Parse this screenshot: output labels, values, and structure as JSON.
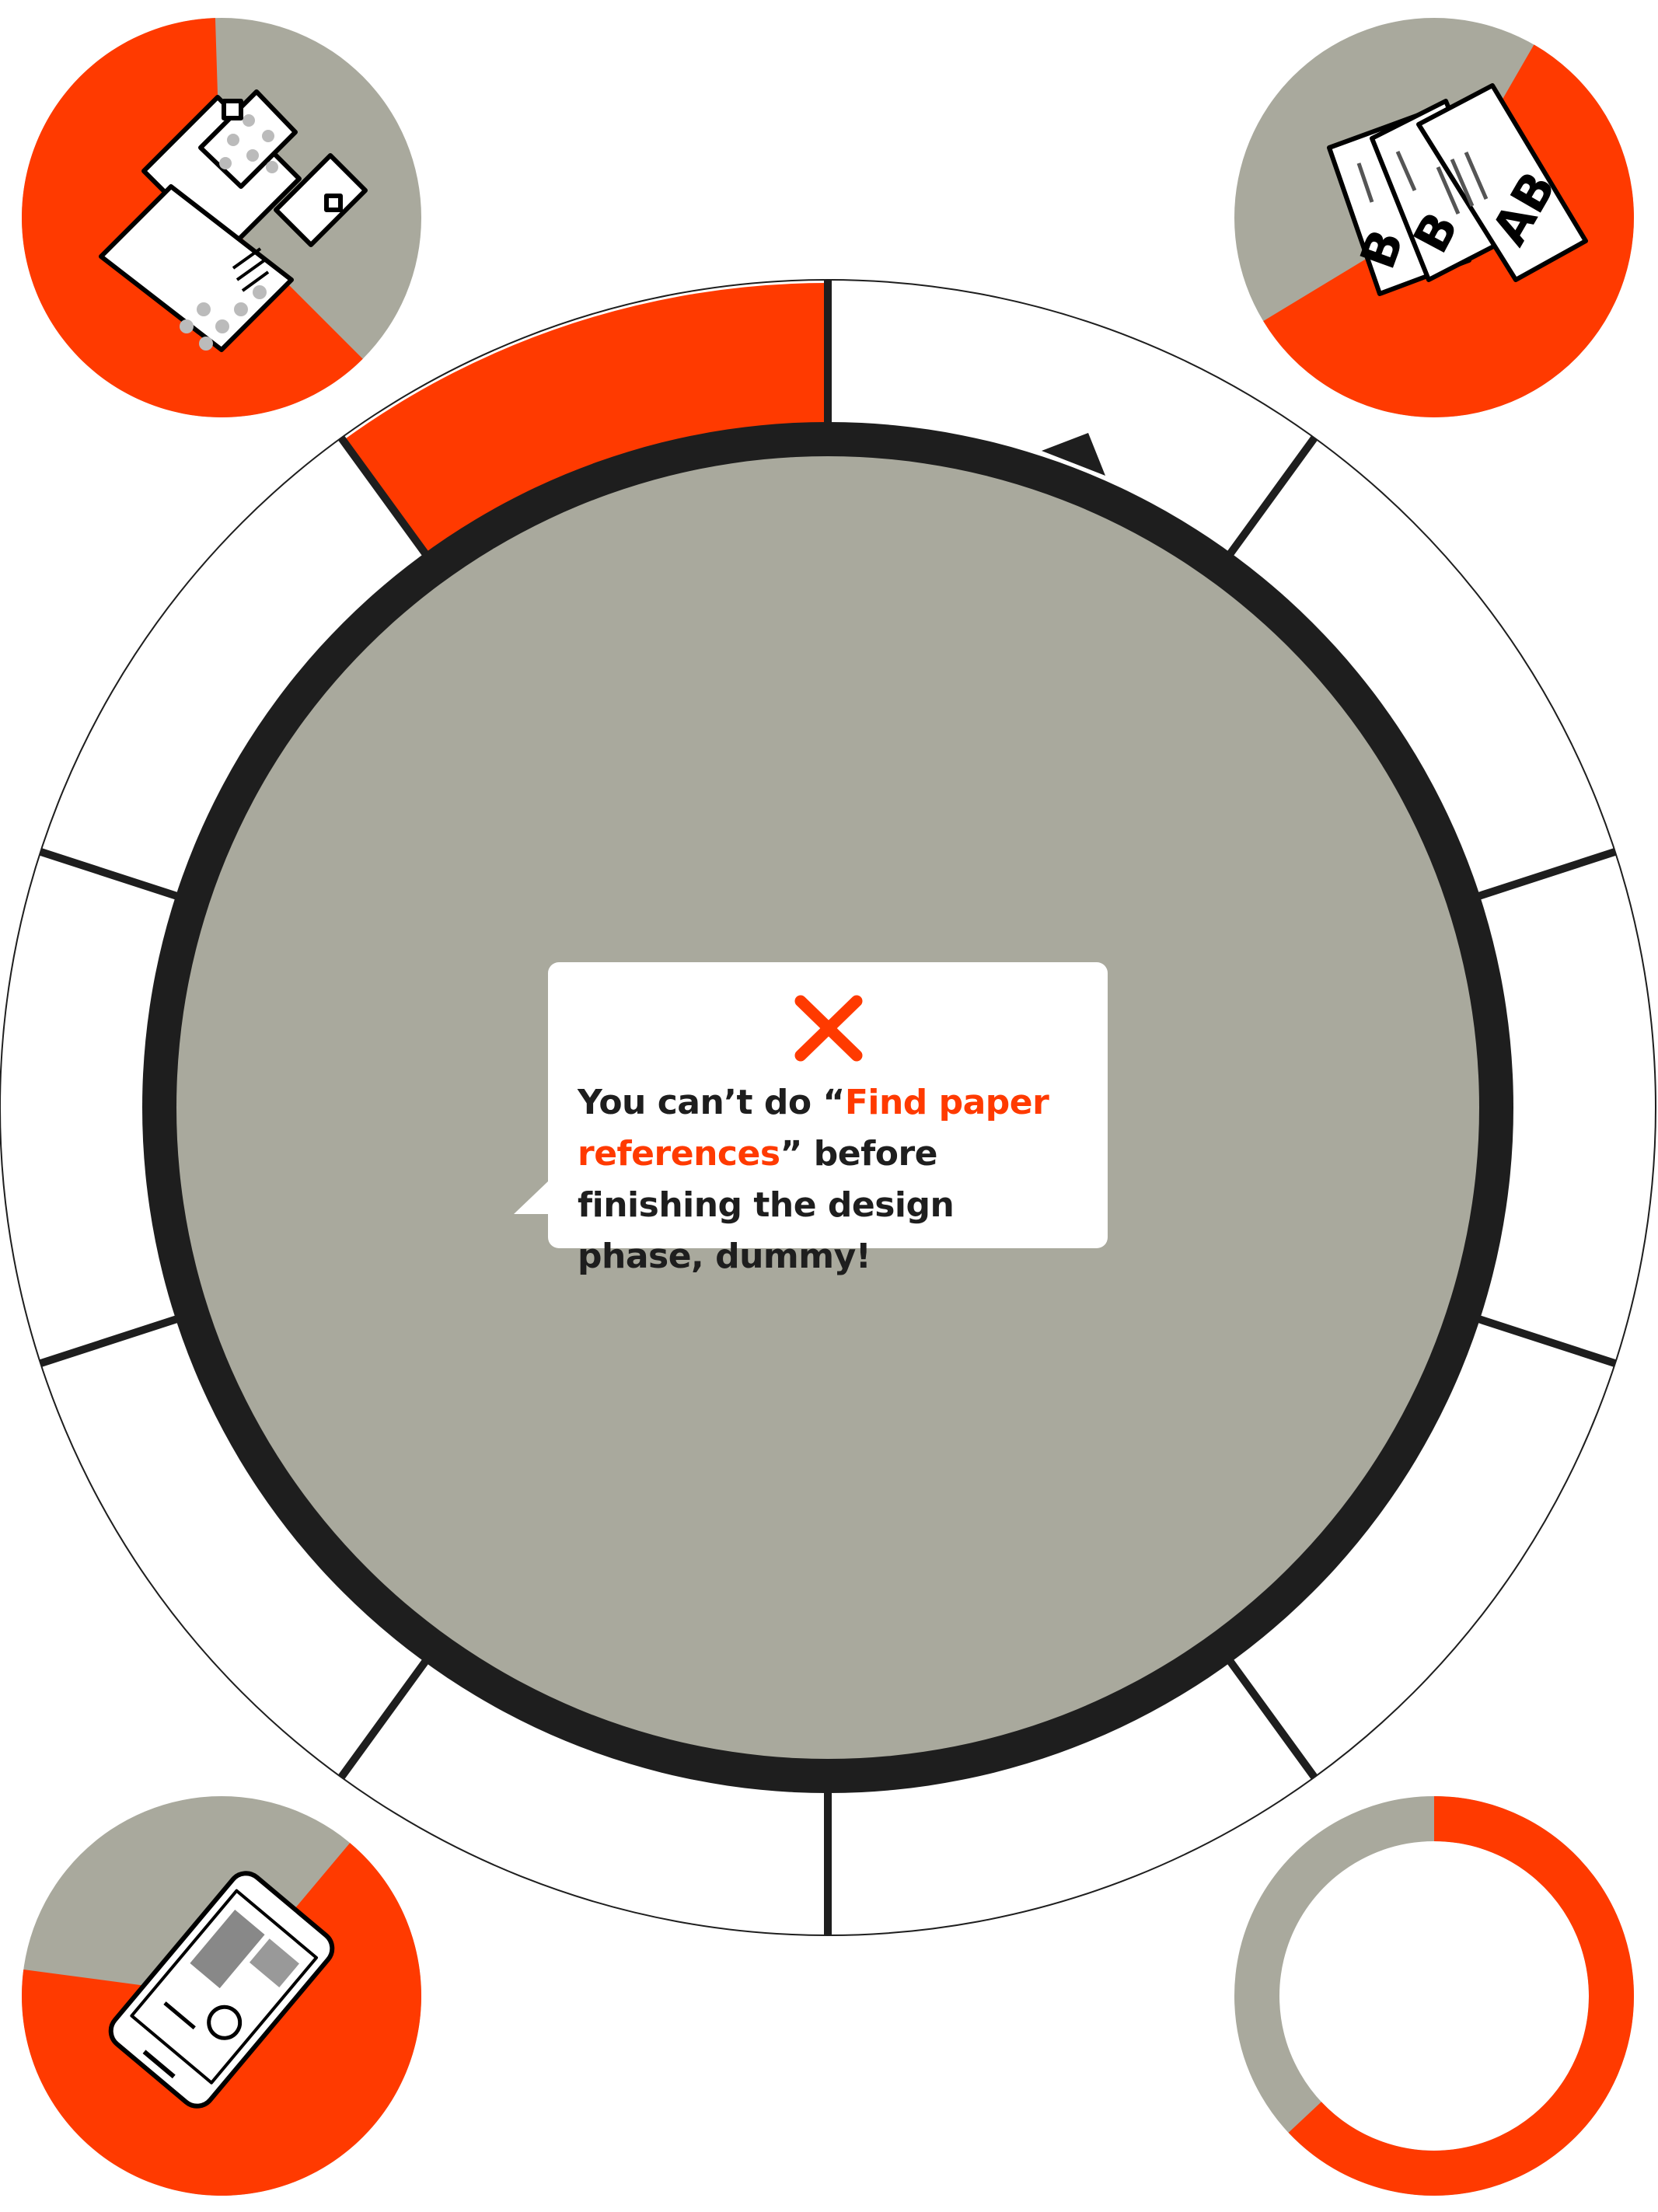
{
  "colors": {
    "accent": "#ff3a00",
    "gray": "#a9a99d",
    "ring_dark": "#1e1e1e",
    "white": "#ffffff"
  },
  "wheel": {
    "segment_count": 10,
    "active_segment_index": 0
  },
  "corner_icons": [
    {
      "name": "mail-envelopes-icon",
      "progress": 0.62
    },
    {
      "name": "letter-cards-icon",
      "progress": 0.58
    },
    {
      "name": "phone-app-icon",
      "progress": 0.66
    },
    {
      "name": "progress-ring-icon",
      "progress": 0.63
    }
  ],
  "error_popup": {
    "icon": "close-icon",
    "message_prefix": "You can’t do “",
    "highlight": "Find paper references",
    "message_suffix": "” before finishing the design phase, dummy!"
  }
}
